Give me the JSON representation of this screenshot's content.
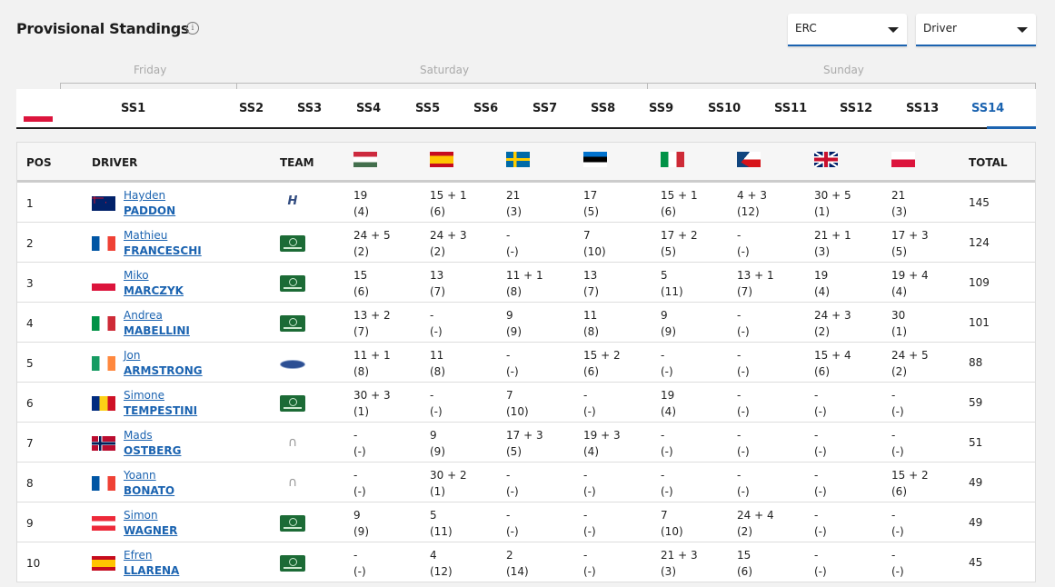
{
  "header": {
    "title": "Provisional Standings",
    "info_icon": "info-icon"
  },
  "selects": {
    "series": "ERC",
    "type": "Driver"
  },
  "days": [
    "Friday",
    "Saturday",
    "Sunday"
  ],
  "tabs": [
    "SS1",
    "SS2",
    "SS3",
    "SS4",
    "SS5",
    "SS6",
    "SS7",
    "SS8",
    "SS9",
    "SS10",
    "SS11",
    "SS12",
    "SS13",
    "SS14"
  ],
  "active_tab": "SS14",
  "columns": {
    "pos": "POS",
    "driver": "DRIVER",
    "team": "TEAM",
    "total": "TOTAL"
  },
  "event_flags": [
    "hungary",
    "spain",
    "sweden",
    "estonia",
    "italy",
    "czech",
    "uk",
    "poland"
  ],
  "rows": [
    {
      "pos": "1",
      "flag": "new-zealand",
      "first": "Hayden",
      "last": "PADDON",
      "team": "hyundai",
      "scores": [
        [
          "19",
          "(4)"
        ],
        [
          "15 + 1",
          "(6)"
        ],
        [
          "21",
          "(3)"
        ],
        [
          "17",
          "(5)"
        ],
        [
          "15 + 1",
          "(6)"
        ],
        [
          "4 + 3",
          "(12)"
        ],
        [
          "30 + 5",
          "(1)"
        ],
        [
          "21",
          "(3)"
        ]
      ],
      "total": "145"
    },
    {
      "pos": "2",
      "flag": "france",
      "first": "Mathieu",
      "last": "FRANCESCHI",
      "team": "skoda",
      "scores": [
        [
          "24 + 5",
          "(2)"
        ],
        [
          "24 + 3",
          "(2)"
        ],
        [
          "-",
          "(-)"
        ],
        [
          "7",
          "(10)"
        ],
        [
          "17 + 2",
          "(5)"
        ],
        [
          "-",
          "(-)"
        ],
        [
          "21 + 1",
          "(3)"
        ],
        [
          "17 + 3",
          "(5)"
        ]
      ],
      "total": "124"
    },
    {
      "pos": "3",
      "flag": "poland",
      "first": "Miko",
      "last": "MARCZYK",
      "team": "skoda",
      "scores": [
        [
          "15",
          "(6)"
        ],
        [
          "13",
          "(7)"
        ],
        [
          "11 + 1",
          "(8)"
        ],
        [
          "13",
          "(7)"
        ],
        [
          "5",
          "(11)"
        ],
        [
          "13 + 1",
          "(7)"
        ],
        [
          "19",
          "(4)"
        ],
        [
          "19 + 4",
          "(4)"
        ]
      ],
      "total": "109"
    },
    {
      "pos": "4",
      "flag": "italy",
      "first": "Andrea",
      "last": "MABELLINI",
      "team": "skoda",
      "scores": [
        [
          "13 + 2",
          "(7)"
        ],
        [
          "-",
          "(-)"
        ],
        [
          "9",
          "(9)"
        ],
        [
          "11",
          "(8)"
        ],
        [
          "9",
          "(9)"
        ],
        [
          "-",
          "(-)"
        ],
        [
          "24 + 3",
          "(2)"
        ],
        [
          "30",
          "(1)"
        ]
      ],
      "total": "101"
    },
    {
      "pos": "5",
      "flag": "ireland",
      "first": "Jon",
      "last": "ARMSTRONG",
      "team": "ford",
      "scores": [
        [
          "11 + 1",
          "(8)"
        ],
        [
          "11",
          "(8)"
        ],
        [
          "-",
          "(-)"
        ],
        [
          "15 + 2",
          "(6)"
        ],
        [
          "-",
          "(-)"
        ],
        [
          "-",
          "(-)"
        ],
        [
          "15 + 4",
          "(6)"
        ],
        [
          "24 + 5",
          "(2)"
        ]
      ],
      "total": "88"
    },
    {
      "pos": "6",
      "flag": "romania",
      "first": "Simone",
      "last": "TEMPESTINI",
      "team": "skoda",
      "scores": [
        [
          "30 + 3",
          "(1)"
        ],
        [
          "-",
          "(-)"
        ],
        [
          "7",
          "(10)"
        ],
        [
          "-",
          "(-)"
        ],
        [
          "19",
          "(4)"
        ],
        [
          "-",
          "(-)"
        ],
        [
          "-",
          "(-)"
        ],
        [
          "-",
          "(-)"
        ]
      ],
      "total": "59"
    },
    {
      "pos": "7",
      "flag": "norway",
      "first": "Mads",
      "last": "OSTBERG",
      "team": "citroen",
      "scores": [
        [
          "-",
          "(-)"
        ],
        [
          "9",
          "(9)"
        ],
        [
          "17 + 3",
          "(5)"
        ],
        [
          "19 + 3",
          "(4)"
        ],
        [
          "-",
          "(-)"
        ],
        [
          "-",
          "(-)"
        ],
        [
          "-",
          "(-)"
        ],
        [
          "-",
          "(-)"
        ]
      ],
      "total": "51"
    },
    {
      "pos": "8",
      "flag": "france",
      "first": "Yoann",
      "last": "BONATO",
      "team": "citroen",
      "scores": [
        [
          "-",
          "(-)"
        ],
        [
          "30 + 2",
          "(1)"
        ],
        [
          "-",
          "(-)"
        ],
        [
          "-",
          "(-)"
        ],
        [
          "-",
          "(-)"
        ],
        [
          "-",
          "(-)"
        ],
        [
          "-",
          "(-)"
        ],
        [
          "15 + 2",
          "(6)"
        ]
      ],
      "total": "49"
    },
    {
      "pos": "9",
      "flag": "austria",
      "first": "Simon",
      "last": "WAGNER",
      "team": "skoda",
      "scores": [
        [
          "9",
          "(9)"
        ],
        [
          "5",
          "(11)"
        ],
        [
          "-",
          "(-)"
        ],
        [
          "-",
          "(-)"
        ],
        [
          "7",
          "(10)"
        ],
        [
          "24 + 4",
          "(2)"
        ],
        [
          "-",
          "(-)"
        ],
        [
          "-",
          "(-)"
        ]
      ],
      "total": "49"
    },
    {
      "pos": "10",
      "flag": "spain",
      "first": "Efren",
      "last": "LLARENA",
      "team": "skoda",
      "scores": [
        [
          "-",
          "(-)"
        ],
        [
          "4",
          "(12)"
        ],
        [
          "2",
          "(14)"
        ],
        [
          "-",
          "(-)"
        ],
        [
          "21 + 3",
          "(3)"
        ],
        [
          "15",
          "(6)"
        ],
        [
          "-",
          "(-)"
        ],
        [
          "-",
          "(-)"
        ]
      ],
      "total": "45"
    }
  ]
}
